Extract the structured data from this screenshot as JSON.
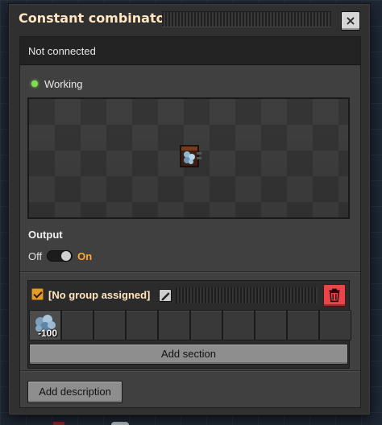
{
  "window": {
    "title": "Constant combinator",
    "close_icon": "×"
  },
  "connection": {
    "text": "Not connected"
  },
  "status": {
    "text": "Working",
    "color": "#7ee04a"
  },
  "entity_preview": {
    "icon": "constant-combinator-icon"
  },
  "output": {
    "label": "Output",
    "off_label": "Off",
    "on_label": "On",
    "enabled": true
  },
  "section": {
    "group_checked": true,
    "group_name": "[No group assigned]",
    "edit_icon": "pencil-icon",
    "delete_icon": "trash-icon",
    "signals": [
      {
        "icon": "iron-ore-icon",
        "count": "-100"
      }
    ],
    "empty_slot_count": 9,
    "add_section_label": "Add section"
  },
  "footer": {
    "add_description_label": "Add description"
  },
  "colors": {
    "accent": "#ffa92e",
    "title": "#ffe6c0",
    "delete": "#e8464a"
  }
}
